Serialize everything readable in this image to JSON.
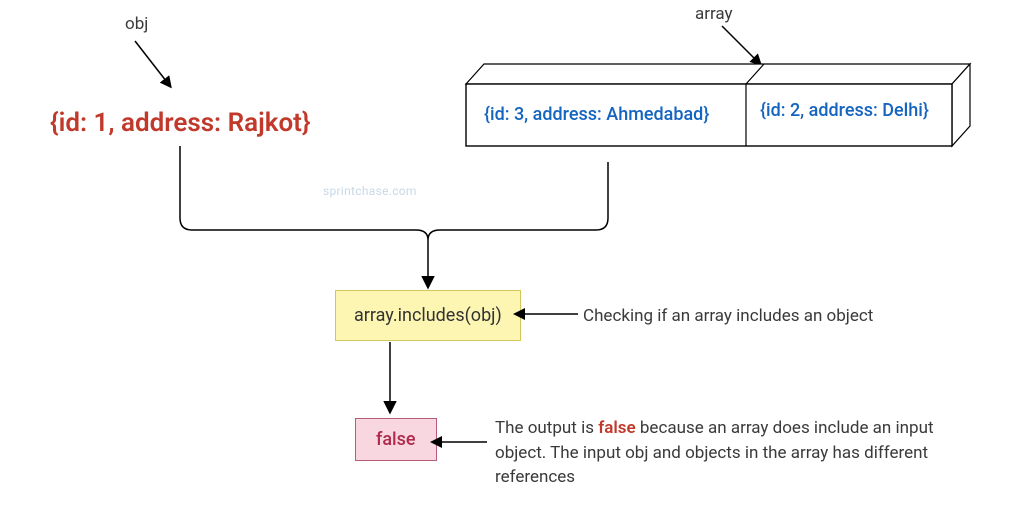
{
  "labels": {
    "obj": "obj",
    "array": "array",
    "check_desc": "Checking if an array includes an object",
    "watermark": "sprintchase.com"
  },
  "obj_text": "{id: 1, address: Rajkot}",
  "array_cells": {
    "0": "{id: 3, address: Ahmedabad}",
    "1": "{id: 2, address: Delhi}"
  },
  "method": "array.includes(obj)",
  "result": "false",
  "explain": {
    "pre": "The output is ",
    "kw": "false",
    "post": " because an array does include an input object. The input obj and objects in the array has different references"
  }
}
